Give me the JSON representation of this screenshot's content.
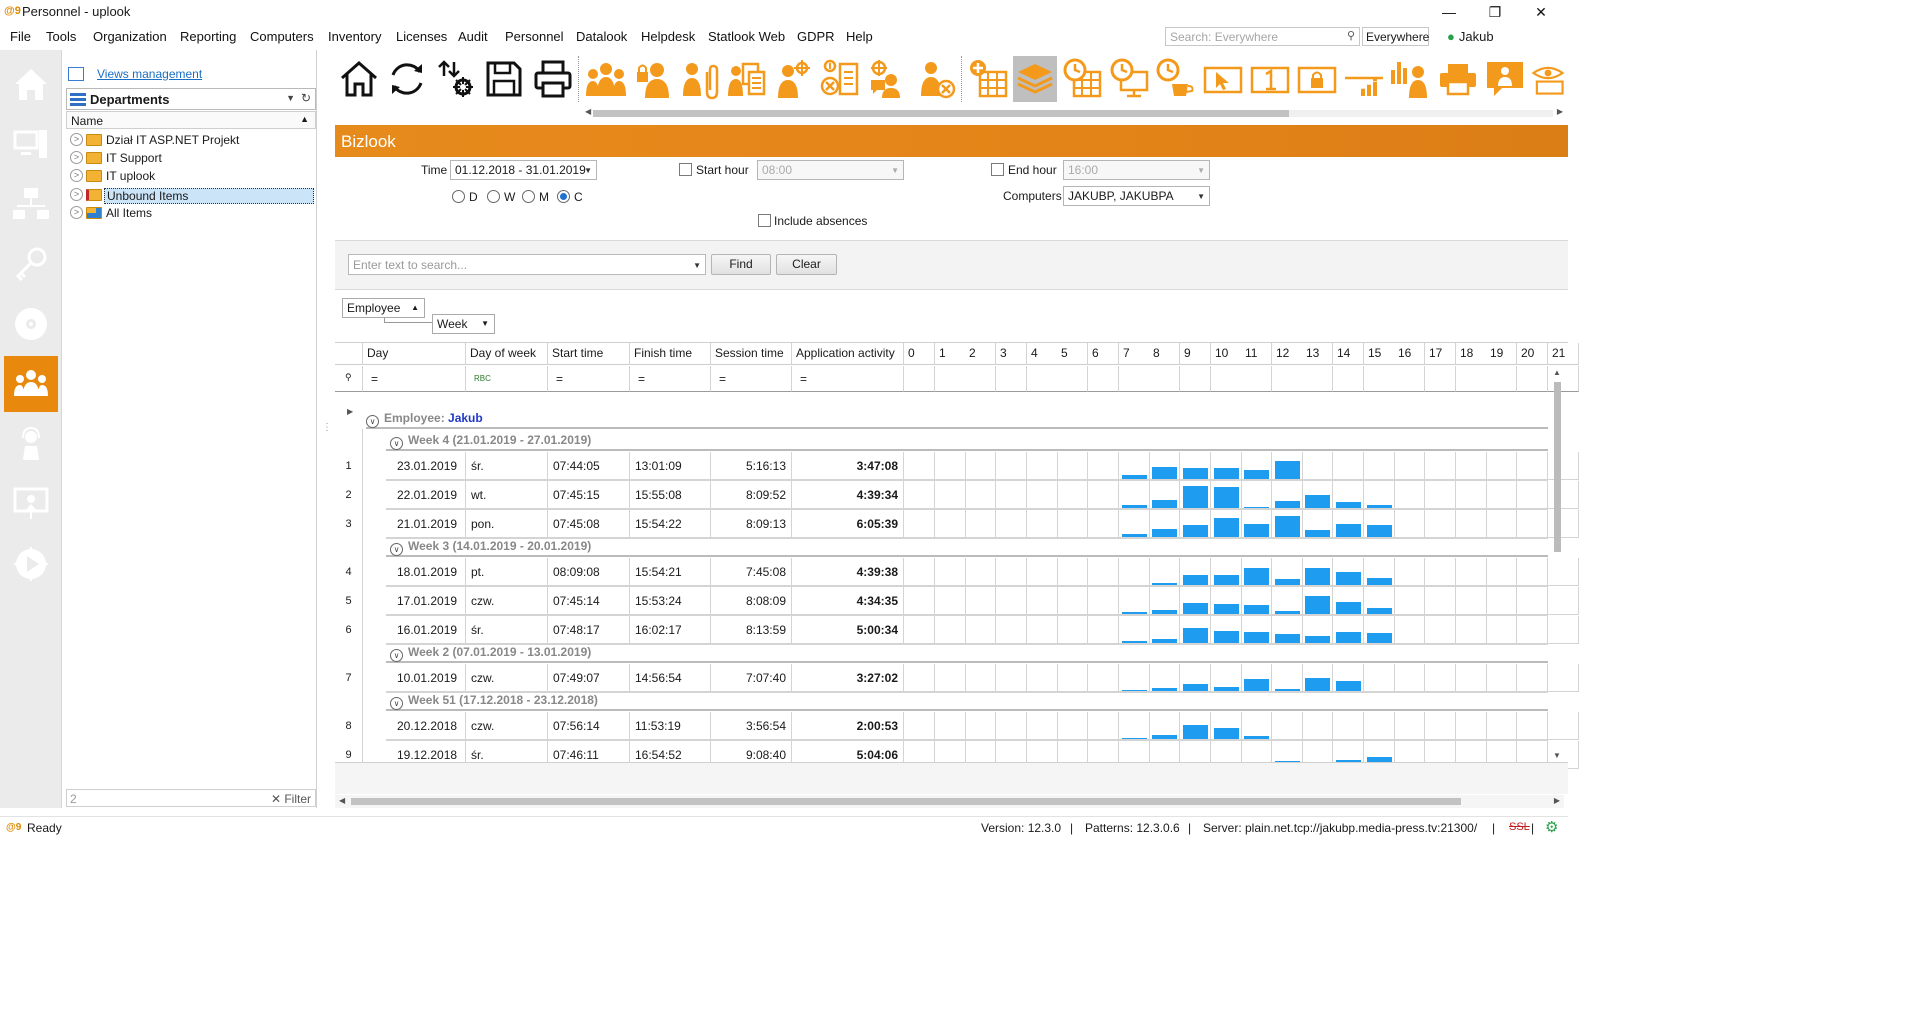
{
  "window": {
    "title": "Personnel - uplook",
    "logo_text": "@9"
  },
  "menu": [
    "File",
    "Tools",
    "Organization",
    "Reporting",
    "Computers",
    "Inventory",
    "Licenses",
    "Audit",
    "Personnel",
    "Datalook",
    "Helpdesk",
    "Statlook Web",
    "GDPR",
    "Help"
  ],
  "global_search": {
    "placeholder": "Search: Everywhere",
    "scope": "Everywhere"
  },
  "user": {
    "name": "Jakub"
  },
  "left_panel": {
    "views_management": "Views management",
    "dropdown_title": "Departments",
    "column_header": "Name",
    "tree": [
      "Dział IT ASP.NET Projekt",
      "IT Support",
      "IT uplook",
      "Unbound Items",
      "All Items"
    ],
    "selected": "Unbound Items",
    "filter_value": "2",
    "filter_label": "Filter"
  },
  "sidebar_icons": [
    "home",
    "computers",
    "network",
    "licenses-key",
    "disc",
    "personnel",
    "helpdesk",
    "presentation",
    "statlook-play"
  ],
  "sidebar_active": "personnel",
  "toolbar_icons": [
    "home-icon",
    "refresh-icon",
    "import-export-icon",
    "save-icon",
    "print-icon",
    "group-users-icon",
    "lock-user-icon",
    "user-attachment-icon",
    "user-documents-icon",
    "user-group-settings-icon",
    "user-remove-document-icon",
    "user-settings-chat-icon",
    "user-remove-icon",
    "add-grid-icon",
    "layers-icon",
    "clock-grid-icon",
    "clock-monitor-icon",
    "clock-cup-icon",
    "cursor-icon",
    "number-one-icon",
    "lock-icon",
    "chart-rising-icon",
    "bar-chart-user-icon",
    "user-orange-icon",
    "printer-icon",
    "user-chat-icon",
    "www-eye-icon"
  ],
  "toolbar_selected": "layers-icon",
  "header": {
    "title": "Bizlook",
    "accent_color": "#e38418"
  },
  "filters": {
    "time_label": "Time",
    "time_value": "01.12.2018 - 31.01.2019",
    "period_options": [
      "D",
      "W",
      "M",
      "C"
    ],
    "period_selected": "C",
    "start_hour_label": "Start hour",
    "start_hour_value": "08:00",
    "start_hour_checked": false,
    "end_hour_label": "End hour",
    "end_hour_value": "16:00",
    "end_hour_checked": false,
    "computers_label": "Computers",
    "computers_value": "JAKUBP, JAKUBPA",
    "include_absences_label": "Include absences",
    "include_absences_checked": false
  },
  "search": {
    "placeholder": "Enter text to search...",
    "find_label": "Find",
    "clear_label": "Clear"
  },
  "grouping": {
    "group1": "Employee",
    "group2": "Week"
  },
  "grid": {
    "columns": [
      "Day",
      "Day of week",
      "Start time",
      "Finish time",
      "Session time",
      "Application activity"
    ],
    "hours": [
      "0",
      "1",
      "2",
      "3",
      "4",
      "5",
      "6",
      "7",
      "8",
      "9",
      "10",
      "11",
      "12",
      "13",
      "14",
      "15",
      "16",
      "17",
      "18",
      "19",
      "20",
      "21"
    ],
    "filter_symbols": [
      "=",
      "RBC",
      "=",
      "=",
      "=",
      "="
    ],
    "employee_label": "Employee:",
    "employee_name": "Jakub",
    "weeks": [
      {
        "label": "Week 4 (21.01.2019 - 27.01.2019)",
        "rows": [
          {
            "num": "1",
            "day": "23.01.2019",
            "dow": "śr.",
            "start": "07:44:05",
            "finish": "13:01:09",
            "session": "5:16:13",
            "activity": "3:47:08",
            "bars": {
              "7": 0.2,
              "8": 0.55,
              "9": 0.5,
              "10": 0.5,
              "11": 0.4,
              "12": 0.8
            }
          },
          {
            "num": "2",
            "day": "22.01.2019",
            "dow": "wt.",
            "start": "07:45:15",
            "finish": "15:55:08",
            "session": "8:09:52",
            "activity": "4:39:34",
            "bars": {
              "7": 0.15,
              "8": 0.35,
              "9": 1.0,
              "10": 0.95,
              "11": 0.05,
              "12": 0.3,
              "13": 0.6,
              "14": 0.25,
              "15": 0.15
            }
          },
          {
            "num": "3",
            "day": "21.01.2019",
            "dow": "pon.",
            "start": "07:45:08",
            "finish": "15:54:22",
            "session": "8:09:13",
            "activity": "6:05:39",
            "bars": {
              "7": 0.15,
              "8": 0.35,
              "9": 0.55,
              "10": 0.85,
              "11": 0.6,
              "12": 0.95,
              "13": 0.3,
              "14": 0.6,
              "15": 0.55
            }
          }
        ]
      },
      {
        "label": "Week 3 (14.01.2019 - 20.01.2019)",
        "rows": [
          {
            "num": "4",
            "day": "18.01.2019",
            "dow": "pt.",
            "start": "08:09:08",
            "finish": "15:54:21",
            "session": "7:45:08",
            "activity": "4:39:38",
            "bars": {
              "8": 0.1,
              "9": 0.45,
              "10": 0.45,
              "11": 0.75,
              "12": 0.25,
              "13": 0.75,
              "14": 0.6,
              "15": 0.3
            }
          },
          {
            "num": "5",
            "day": "17.01.2019",
            "dow": "czw.",
            "start": "07:45:14",
            "finish": "15:53:24",
            "session": "8:08:09",
            "activity": "4:34:35",
            "bars": {
              "7": 0.1,
              "8": 0.2,
              "9": 0.5,
              "10": 0.45,
              "11": 0.4,
              "12": 0.15,
              "13": 0.8,
              "14": 0.55,
              "15": 0.25
            }
          },
          {
            "num": "6",
            "day": "16.01.2019",
            "dow": "śr.",
            "start": "07:48:17",
            "finish": "16:02:17",
            "session": "8:13:59",
            "activity": "5:00:34",
            "bars": {
              "7": 0.1,
              "8": 0.2,
              "9": 0.7,
              "10": 0.55,
              "11": 0.5,
              "12": 0.4,
              "13": 0.3,
              "14": 0.5,
              "15": 0.45
            }
          }
        ]
      },
      {
        "label": "Week 2 (07.01.2019 - 13.01.2019)",
        "rows": [
          {
            "num": "7",
            "day": "10.01.2019",
            "dow": "czw.",
            "start": "07:49:07",
            "finish": "14:56:54",
            "session": "7:07:40",
            "activity": "3:27:02",
            "bars": {
              "7": 0.05,
              "8": 0.15,
              "9": 0.3,
              "10": 0.2,
              "11": 0.55,
              "12": 0.1,
              "13": 0.6,
              "14": 0.45
            }
          }
        ]
      },
      {
        "label": "Week 51 (17.12.2018 - 23.12.2018)",
        "rows": [
          {
            "num": "8",
            "day": "20.12.2018",
            "dow": "czw.",
            "start": "07:56:14",
            "finish": "11:53:19",
            "session": "3:56:54",
            "activity": "2:00:53",
            "bars": {
              "7": 0.04,
              "8": 0.2,
              "9": 0.65,
              "10": 0.5,
              "11": 0.12
            }
          },
          {
            "num": "9",
            "day": "19.12.2018",
            "dow": "śr.",
            "start": "07:46:11",
            "finish": "16:54:52",
            "session": "9:08:40",
            "activity": "5:04:06",
            "bars": {
              "12": 0.3,
              "14": 0.35,
              "15": 0.5
            }
          }
        ]
      }
    ]
  },
  "status": {
    "ready": "Ready",
    "version": "Version: 12.3.0",
    "patterns": "Patterns: 12.3.0.6",
    "server": "Server: plain.net.tcp://jakubp.media-press.tv:21300/",
    "ssl": "SSL",
    "separator": "|"
  }
}
